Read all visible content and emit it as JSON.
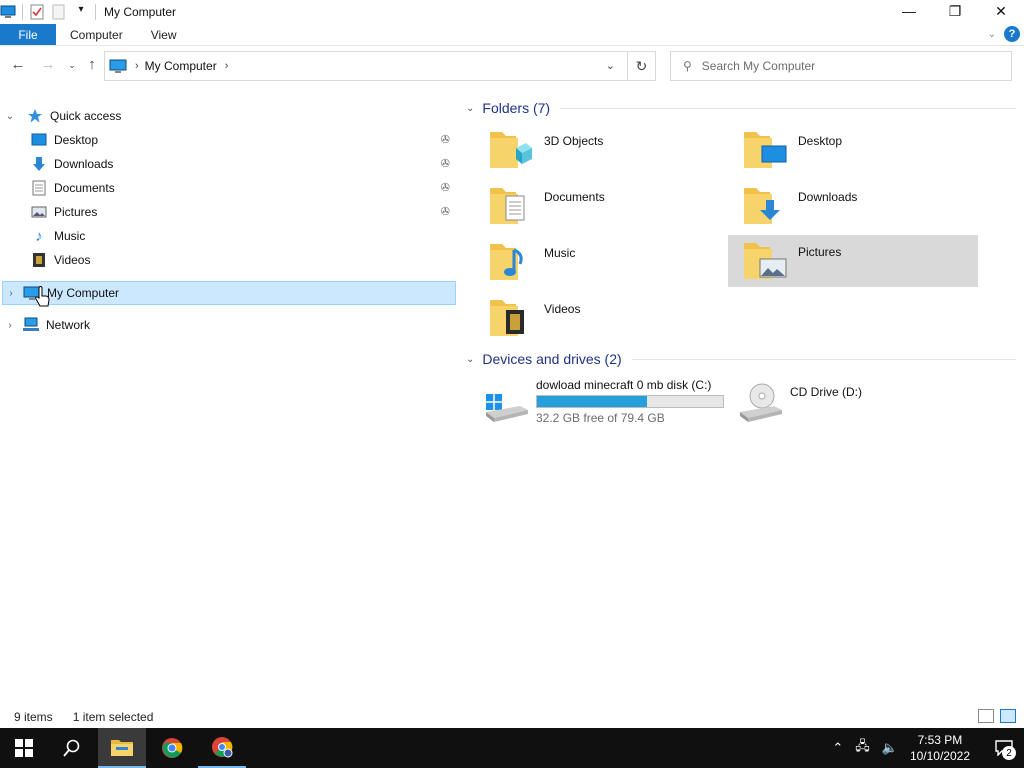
{
  "window": {
    "title": "My Computer",
    "minimize": "—",
    "restore": "❐",
    "close": "✕"
  },
  "ribbon": {
    "tabs": [
      "File",
      "Computer",
      "View"
    ],
    "help": "?"
  },
  "address": {
    "crumb": "My Computer",
    "search_placeholder": "Search My Computer"
  },
  "nav": {
    "quick_access": "Quick access",
    "items": [
      {
        "label": "Desktop",
        "pinned": true
      },
      {
        "label": "Downloads",
        "pinned": true
      },
      {
        "label": "Documents",
        "pinned": true
      },
      {
        "label": "Pictures",
        "pinned": true
      },
      {
        "label": "Music",
        "pinned": false
      },
      {
        "label": "Videos",
        "pinned": false
      }
    ],
    "my_computer": "My Computer",
    "network": "Network"
  },
  "content": {
    "folders_header": "Folders (7)",
    "folders": [
      "3D Objects",
      "Desktop",
      "Documents",
      "Downloads",
      "Music",
      "Pictures",
      "Videos"
    ],
    "selected_folder": "Pictures",
    "devices_header": "Devices and drives (2)",
    "drives": [
      {
        "name": "dowload minecraft 0 mb disk (C:)",
        "free": "32.2 GB free of 79.4 GB",
        "used_fraction": 0.594
      },
      {
        "name": "CD Drive (D:)"
      }
    ]
  },
  "status": {
    "items": "9 items",
    "selected": "1 item selected"
  },
  "taskbar": {
    "time": "7:53 PM",
    "date": "10/10/2022",
    "notifications": "2"
  },
  "colors": {
    "accent": "#1979ca",
    "drive_bar": "#26a0da",
    "selection": "#cce8ff",
    "header_text": "#1e3287"
  }
}
